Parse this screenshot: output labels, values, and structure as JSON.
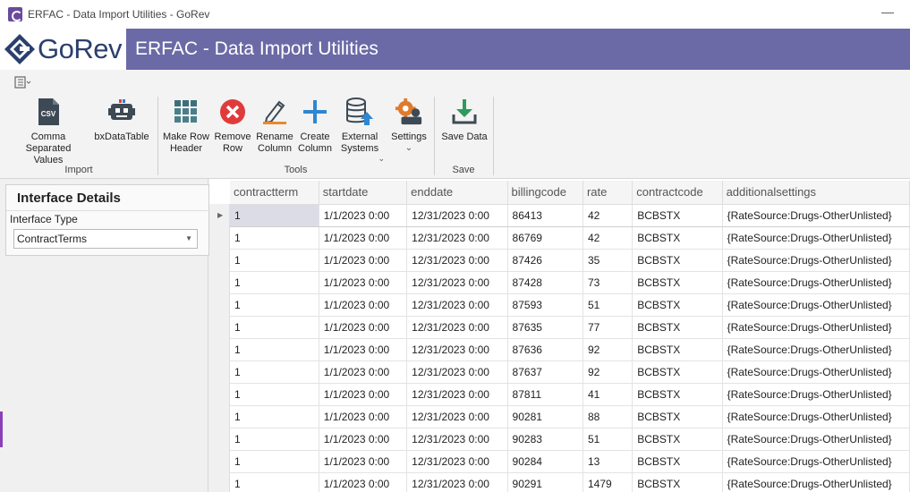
{
  "window": {
    "title": "ERFAC - Data Import Utilities - GoRev",
    "minimize_glyph": "—"
  },
  "banner": {
    "logo_text": "GoRev",
    "title": "ERFAC - Data Import Utilities",
    "color": "#6b6aa6"
  },
  "ribbon": {
    "groups": [
      {
        "label": "Import",
        "buttons": [
          "Comma Separated Values",
          "bxDataTable"
        ]
      },
      {
        "label": "Tools",
        "buttons": [
          "Make Row Header",
          "Remove Row",
          "Rename Column",
          "Create Column",
          "External Systems",
          "Settings"
        ]
      },
      {
        "label": "Save",
        "buttons": [
          "Save Data"
        ]
      }
    ],
    "csv": {
      "line1": "Comma Separated",
      "line2": "Values",
      "icon_text": "CSV"
    },
    "bx": {
      "line1": "bxDataTable"
    },
    "make_row_header": {
      "line1": "Make Row",
      "line2": "Header"
    },
    "remove_row": {
      "line1": "Remove",
      "line2": "Row"
    },
    "rename_column": {
      "line1": "Rename",
      "line2": "Column"
    },
    "create_column": {
      "line1": "Create",
      "line2": "Column"
    },
    "external_systems": {
      "line1": "External",
      "line2": "Systems"
    },
    "settings": {
      "line1": "Settings"
    },
    "save_data": {
      "line1": "Save Data"
    },
    "group_import": "Import",
    "group_tools": "Tools",
    "group_save": "Save"
  },
  "interface_details": {
    "title": "Interface Details",
    "type_label": "Interface Type",
    "type_value": "ContractTerms"
  },
  "grid": {
    "columns": [
      "contractterm",
      "startdate",
      "enddate",
      "billingcode",
      "rate",
      "contractcode",
      "additionalsettings"
    ],
    "rows": [
      [
        "1",
        "1/1/2023 0:00",
        "12/31/2023 0:00",
        "86413",
        "42",
        "BCBSTX",
        "{RateSource:Drugs-OtherUnlisted}"
      ],
      [
        "1",
        "1/1/2023 0:00",
        "12/31/2023 0:00",
        "86769",
        "42",
        "BCBSTX",
        "{RateSource:Drugs-OtherUnlisted}"
      ],
      [
        "1",
        "1/1/2023 0:00",
        "12/31/2023 0:00",
        "87426",
        "35",
        "BCBSTX",
        "{RateSource:Drugs-OtherUnlisted}"
      ],
      [
        "1",
        "1/1/2023 0:00",
        "12/31/2023 0:00",
        "87428",
        "73",
        "BCBSTX",
        "{RateSource:Drugs-OtherUnlisted}"
      ],
      [
        "1",
        "1/1/2023 0:00",
        "12/31/2023 0:00",
        "87593",
        "51",
        "BCBSTX",
        "{RateSource:Drugs-OtherUnlisted}"
      ],
      [
        "1",
        "1/1/2023 0:00",
        "12/31/2023 0:00",
        "87635",
        "77",
        "BCBSTX",
        "{RateSource:Drugs-OtherUnlisted}"
      ],
      [
        "1",
        "1/1/2023 0:00",
        "12/31/2023 0:00",
        "87636",
        "92",
        "BCBSTX",
        "{RateSource:Drugs-OtherUnlisted}"
      ],
      [
        "1",
        "1/1/2023 0:00",
        "12/31/2023 0:00",
        "87637",
        "92",
        "BCBSTX",
        "{RateSource:Drugs-OtherUnlisted}"
      ],
      [
        "1",
        "1/1/2023 0:00",
        "12/31/2023 0:00",
        "87811",
        "41",
        "BCBSTX",
        "{RateSource:Drugs-OtherUnlisted}"
      ],
      [
        "1",
        "1/1/2023 0:00",
        "12/31/2023 0:00",
        "90281",
        "88",
        "BCBSTX",
        "{RateSource:Drugs-OtherUnlisted}"
      ],
      [
        "1",
        "1/1/2023 0:00",
        "12/31/2023 0:00",
        "90283",
        "51",
        "BCBSTX",
        "{RateSource:Drugs-OtherUnlisted}"
      ],
      [
        "1",
        "1/1/2023 0:00",
        "12/31/2023 0:00",
        "90284",
        "13",
        "BCBSTX",
        "{RateSource:Drugs-OtherUnlisted}"
      ],
      [
        "1",
        "1/1/2023 0:00",
        "12/31/2023 0:00",
        "90291",
        "1479",
        "BCBSTX",
        "{RateSource:Drugs-OtherUnlisted}"
      ]
    ],
    "selected_row": 0
  },
  "icons": {
    "csv": "csv-file-icon",
    "bx": "robot-icon",
    "make_row_header": "grid-icon",
    "remove_row": "remove-circle-icon",
    "rename_column": "pencil-icon",
    "create_column": "plus-icon",
    "external_systems": "database-upload-icon",
    "settings": "gear-icon",
    "save_data": "download-icon"
  }
}
